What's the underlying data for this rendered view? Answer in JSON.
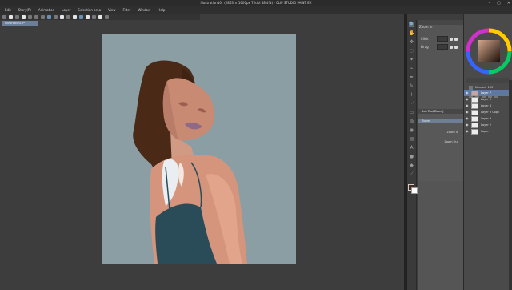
{
  "app": {
    "title": "Illustration10* (2863 × 1600px 72dpi 48.4%) - CLIP STUDIO PAINT EX",
    "window_controls": [
      "–",
      "▢",
      "✕"
    ]
  },
  "menu": [
    "Edit",
    "Story(P)",
    "Animation",
    "Layer",
    "Selection area",
    "View",
    "Filter",
    "Window",
    "Help"
  ],
  "document_tab": "Illustration10*",
  "subtool": {
    "title": "Zoom in",
    "click_label": "Click",
    "drag_label": "Drag"
  },
  "navigator": {
    "header": "Sub Tool[Zoom]",
    "items": [
      {
        "label": "Zoom",
        "right": ""
      },
      {
        "label": "",
        "right": "Zoom In"
      },
      {
        "label": "",
        "right": "Zoom Out"
      }
    ]
  },
  "colors": {
    "main": "#4a2a17",
    "sub": "#ffffff",
    "accent": "#6d8fb3",
    "canvas_bg": "#8b9ea4"
  },
  "layer_panel": {
    "blend_mode": "Normal",
    "opacity": "100",
    "layers": [
      {
        "name": "Layer 7",
        "selected": true
      },
      {
        "name": "Layer 5",
        "selected": false
      },
      {
        "name": "Layer 4",
        "selected": false
      },
      {
        "name": "Layer 3 Copy",
        "selected": false
      },
      {
        "name": "Layer 3",
        "selected": false
      },
      {
        "name": "Layer 2",
        "selected": false
      },
      {
        "name": "Paper",
        "selected": false
      }
    ]
  },
  "icons": {
    "tools": [
      "zoom-icon",
      "hand-icon",
      "move-icon",
      "lasso-icon",
      "wand-icon",
      "eyedropper-icon",
      "pen-icon",
      "pencil-icon",
      "brush-icon",
      "airbrush-icon",
      "eraser-icon",
      "blend-icon",
      "fill-icon",
      "gradient-icon",
      "text-icon",
      "balloon-icon",
      "figure-icon",
      "ruler-icon"
    ]
  }
}
